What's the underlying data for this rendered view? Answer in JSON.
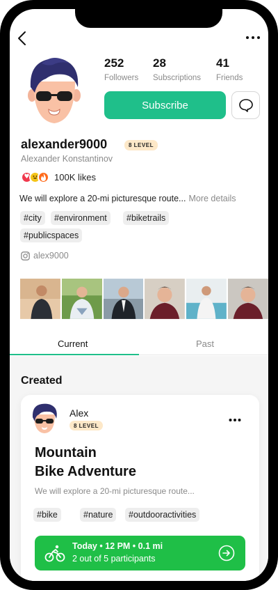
{
  "header": {
    "back_icon": "chevron-left-icon",
    "more_icon": "more-horizontal-icon"
  },
  "profile": {
    "username": "alexander9000",
    "level": "8 LEVEL",
    "full_name": "Alexander Konstantinov",
    "likes": "100K likes",
    "bio": "We will explore a 20-mi picturesque route...",
    "bio_more": "More details",
    "instagram": "alex9000",
    "tags": [
      "#city",
      "#environment",
      "#biketrails",
      "#publicspaces"
    ]
  },
  "stats": [
    {
      "value": "252",
      "label": "Followers"
    },
    {
      "value": "28",
      "label": "Subscriptions"
    },
    {
      "value": "41",
      "label": "Friends"
    }
  ],
  "actions": {
    "subscribe_label": "Subscribe",
    "message_icon": "chat-bubble-icon"
  },
  "tabs": [
    {
      "label": "Current",
      "active": true
    },
    {
      "label": "Past",
      "active": false
    }
  ],
  "section": {
    "created_title": "Created"
  },
  "card": {
    "author": "Alex",
    "level": "8 LEVEL",
    "title_line1": "Mountain",
    "title_line2": "Bike Adventure",
    "description": "We will explore a 20-mi picturesque route...",
    "tags": [
      "#bike",
      "#nature",
      "#outdooractivities"
    ],
    "event_line1": "Today • 12 PM • 0.1 mi",
    "event_line2": "2 out of 5 participants",
    "event_icon": "bicycle-icon",
    "join_icon": "sign-in-icon"
  },
  "colors": {
    "accent": "#1fbf8a",
    "event_green": "#1fbf47",
    "badge_bg": "#fde8c8"
  }
}
